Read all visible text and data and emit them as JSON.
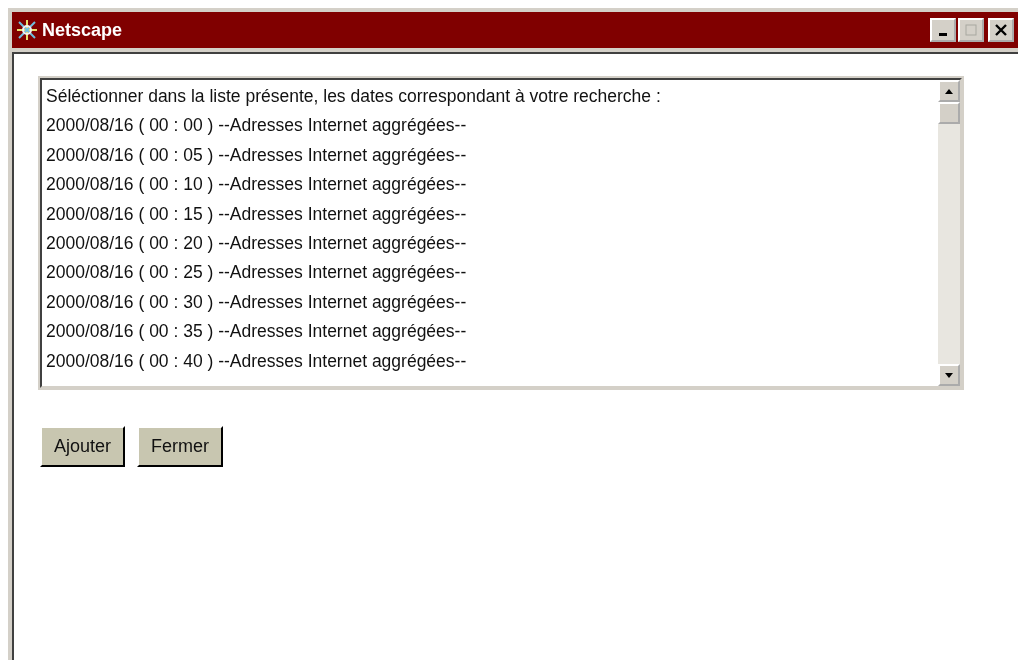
{
  "window": {
    "title": "Netscape"
  },
  "list": {
    "items": [
      {
        "text": "Séléctionner dans la liste présente, les dates correspondant à votre recherche :",
        "selected": false
      },
      {
        "text": "2000/08/16 ( 00 : 00 ) --Adresses Internet aggrégées--",
        "selected": false
      },
      {
        "text": "2000/08/16 ( 00 : 05 ) --Adresses Internet aggrégées--",
        "selected": false
      },
      {
        "text": "2000/08/16 ( 00 : 10 ) --Adresses Internet aggrégées--",
        "selected": false
      },
      {
        "text": "2000/08/16 ( 00 : 15 ) --Adresses Internet aggrégées--",
        "selected": false
      },
      {
        "text": "2000/08/16 ( 00 : 20 ) --Adresses Internet aggrégées--",
        "selected": false
      },
      {
        "text": "2000/08/16 ( 00 : 25 ) --Adresses Internet aggrégées--",
        "selected": false
      },
      {
        "text": "2000/08/16 ( 00 : 30 ) --Adresses Internet aggrégées--",
        "selected": false
      },
      {
        "text": "2000/08/16 ( 00 : 35 ) --Adresses Internet aggrégées--",
        "selected": false
      },
      {
        "text": "2000/08/16 ( 00 : 40 ) --Adresses Internet aggrégées--",
        "selected": false
      }
    ]
  },
  "buttons": [
    "Ajouter",
    "Fermer"
  ]
}
